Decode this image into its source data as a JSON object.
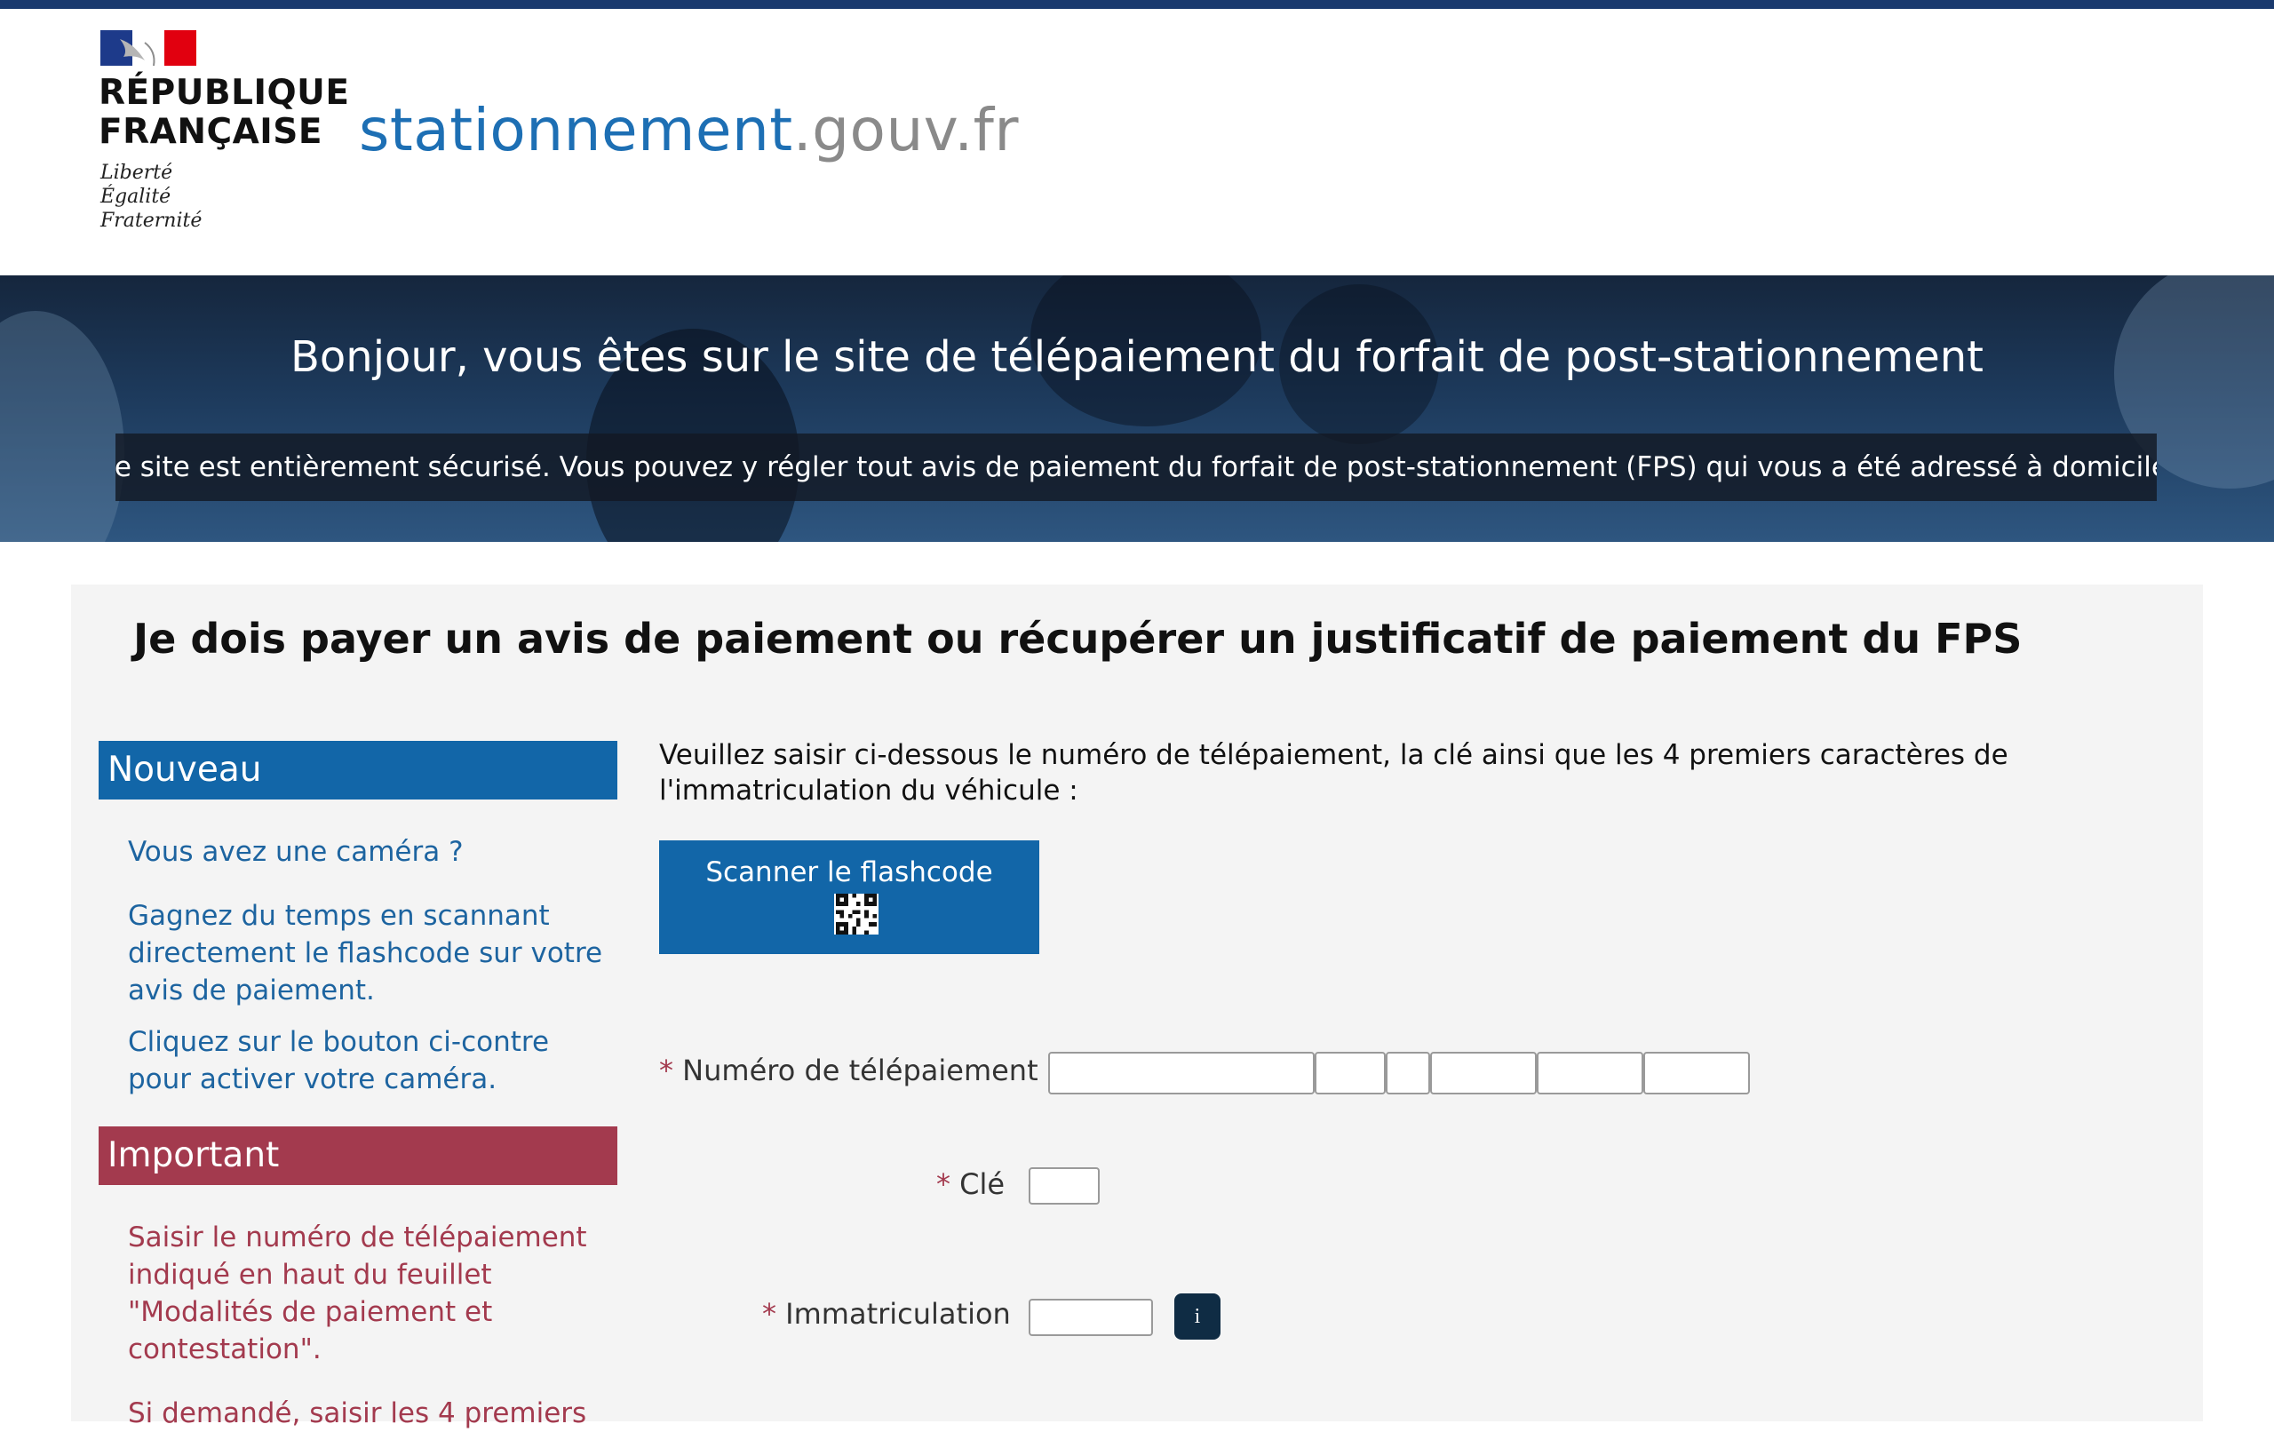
{
  "header": {
    "republic_line1": "RÉPUBLIQUE",
    "republic_line2": "FRANÇAISE",
    "motto": [
      "Liberté",
      "Égalité",
      "Fraternité"
    ],
    "site_name_primary": "stationnement",
    "site_name_secondary": ".gouv.fr"
  },
  "banner": {
    "title": "Bonjour, vous êtes sur le site de télépaiement du forfait de post-stationnement",
    "note": "Ce site est entièrement sécurisé. Vous pouvez y régler tout avis de paiement du forfait de post-stationnement (FPS) qui vous a été adressé à domicile."
  },
  "main": {
    "title": "Je dois payer un avis de paiement ou récupérer un justificatif de paiement du FPS",
    "instructions": "Veuillez saisir ci-dessous le numéro de télépaiement, la clé ainsi que les 4 premiers caractères de l'immatriculation du véhicule :",
    "scan_button": "Scanner le flashcode",
    "fields": {
      "required_mark": "*",
      "payment_number_label": "Numéro de télépaiement",
      "key_label": "Clé",
      "registration_label": "Immatriculation",
      "info_button": "i"
    }
  },
  "sidebar": {
    "new_heading": "Nouveau",
    "new_items": [
      "Vous avez une caméra ?",
      "Gagnez du temps en scannant directement le flashcode sur votre avis de paiement.",
      "Cliquez sur le bouton ci-contre pour activer votre caméra."
    ],
    "important_heading": "Important",
    "important_items": [
      "Saisir le numéro de télépaiement indiqué en haut du feuillet \"Modalités de paiement et contestation\".",
      "Si demandé, saisir les 4 premiers"
    ]
  },
  "colors": {
    "brand_blue": "#1266a8",
    "important_red": "#a33a4e",
    "site_name_blue": "#1d6fb4",
    "top_rule": "#1a3a6e"
  }
}
